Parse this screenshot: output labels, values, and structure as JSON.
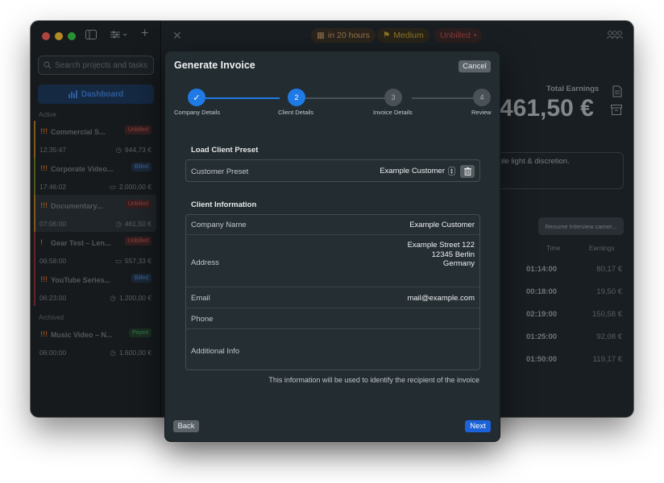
{
  "sidebar": {
    "search_placeholder": "Search projects and tasks",
    "dashboard_label": "Dashboard",
    "active_label": "Active",
    "archived_label": "Archived",
    "projects": [
      {
        "priority": "!!!",
        "name": "Commercial S...",
        "badge": "Unbilled",
        "duration": "12:35:47",
        "amount": "944,73 €",
        "color": "#b07a2a"
      },
      {
        "priority": "!!!",
        "name": "Corporate Video...",
        "badge": "Billed",
        "duration": "17:46:02",
        "amount": "2.000,00 €",
        "color": "#6f7a2c"
      },
      {
        "priority": "!!!",
        "name": "Documentary...",
        "badge": "Unbilled",
        "duration": "07:06:00",
        "amount": "461,50 €",
        "color": "#b07a2a"
      },
      {
        "priority": "!",
        "name": "Gear Test – Len...",
        "badge": "Unbilled",
        "duration": "06:58:00",
        "amount": "557,33 €",
        "color": "#8a3434"
      },
      {
        "priority": "!!!",
        "name": "YouTube Series...",
        "badge": "Billed",
        "duration": "06:23:00",
        "amount": "1.200,00 €",
        "color": "#8a3434"
      }
    ],
    "archived": [
      {
        "priority": "!!!",
        "name": "Music Video – N...",
        "badge": "Payed",
        "duration": "06:00:00",
        "amount": "1.600,00 €",
        "color": "#1f2529"
      }
    ]
  },
  "toolbar": {
    "due_label": "in 20 hours",
    "priority_label": "Medium",
    "billing_label": "Unbilled"
  },
  "detail": {
    "total_label": "Total Earnings",
    "total_value": "461,50 €",
    "notes_text": "ble light & discretion.",
    "resume_label": "Resume Interview camer...",
    "col_time": "Time",
    "col_earnings": "Earnings",
    "entries": [
      {
        "time": "01:14:00",
        "earnings": "80,17 €"
      },
      {
        "time": "00:18:00",
        "earnings": "19,50 €"
      },
      {
        "time": "02:19:00",
        "earnings": "150,58 €"
      },
      {
        "time": "01:25:00",
        "earnings": "92,08 €"
      },
      {
        "time": "01:50:00",
        "earnings": "119,17 €"
      }
    ]
  },
  "modal": {
    "title": "Generate Invoice",
    "cancel_label": "Cancel",
    "back_label": "Back",
    "next_label": "Next",
    "steps": [
      {
        "number": "✓",
        "label": "Company Details"
      },
      {
        "number": "2",
        "label": "Client Details"
      },
      {
        "number": "3",
        "label": "Invoice Details"
      },
      {
        "number": "4",
        "label": "Review"
      }
    ],
    "preset_section_title": "Load Client Preset",
    "preset_label": "Customer Preset",
    "preset_value": "Example Customer",
    "client_section_title": "Client Information",
    "fields": {
      "company_label": "Company Name",
      "company_value": "Example Customer",
      "address_label": "Address",
      "address_line1": "Example Street 122",
      "address_line2": "12345 Berlin",
      "address_line3": "Germany",
      "email_label": "Email",
      "email_value": "mail@example.com",
      "phone_label": "Phone",
      "phone_value": "",
      "info_label": "Additional Info",
      "info_value": ""
    },
    "footnote": "This information will be used to identify the recipient of the invoice"
  },
  "colors": {
    "accent": "#1f7ae6",
    "next_button": "#1c62d8",
    "unbilled": "#c0504f",
    "medium": "#c7a232"
  }
}
